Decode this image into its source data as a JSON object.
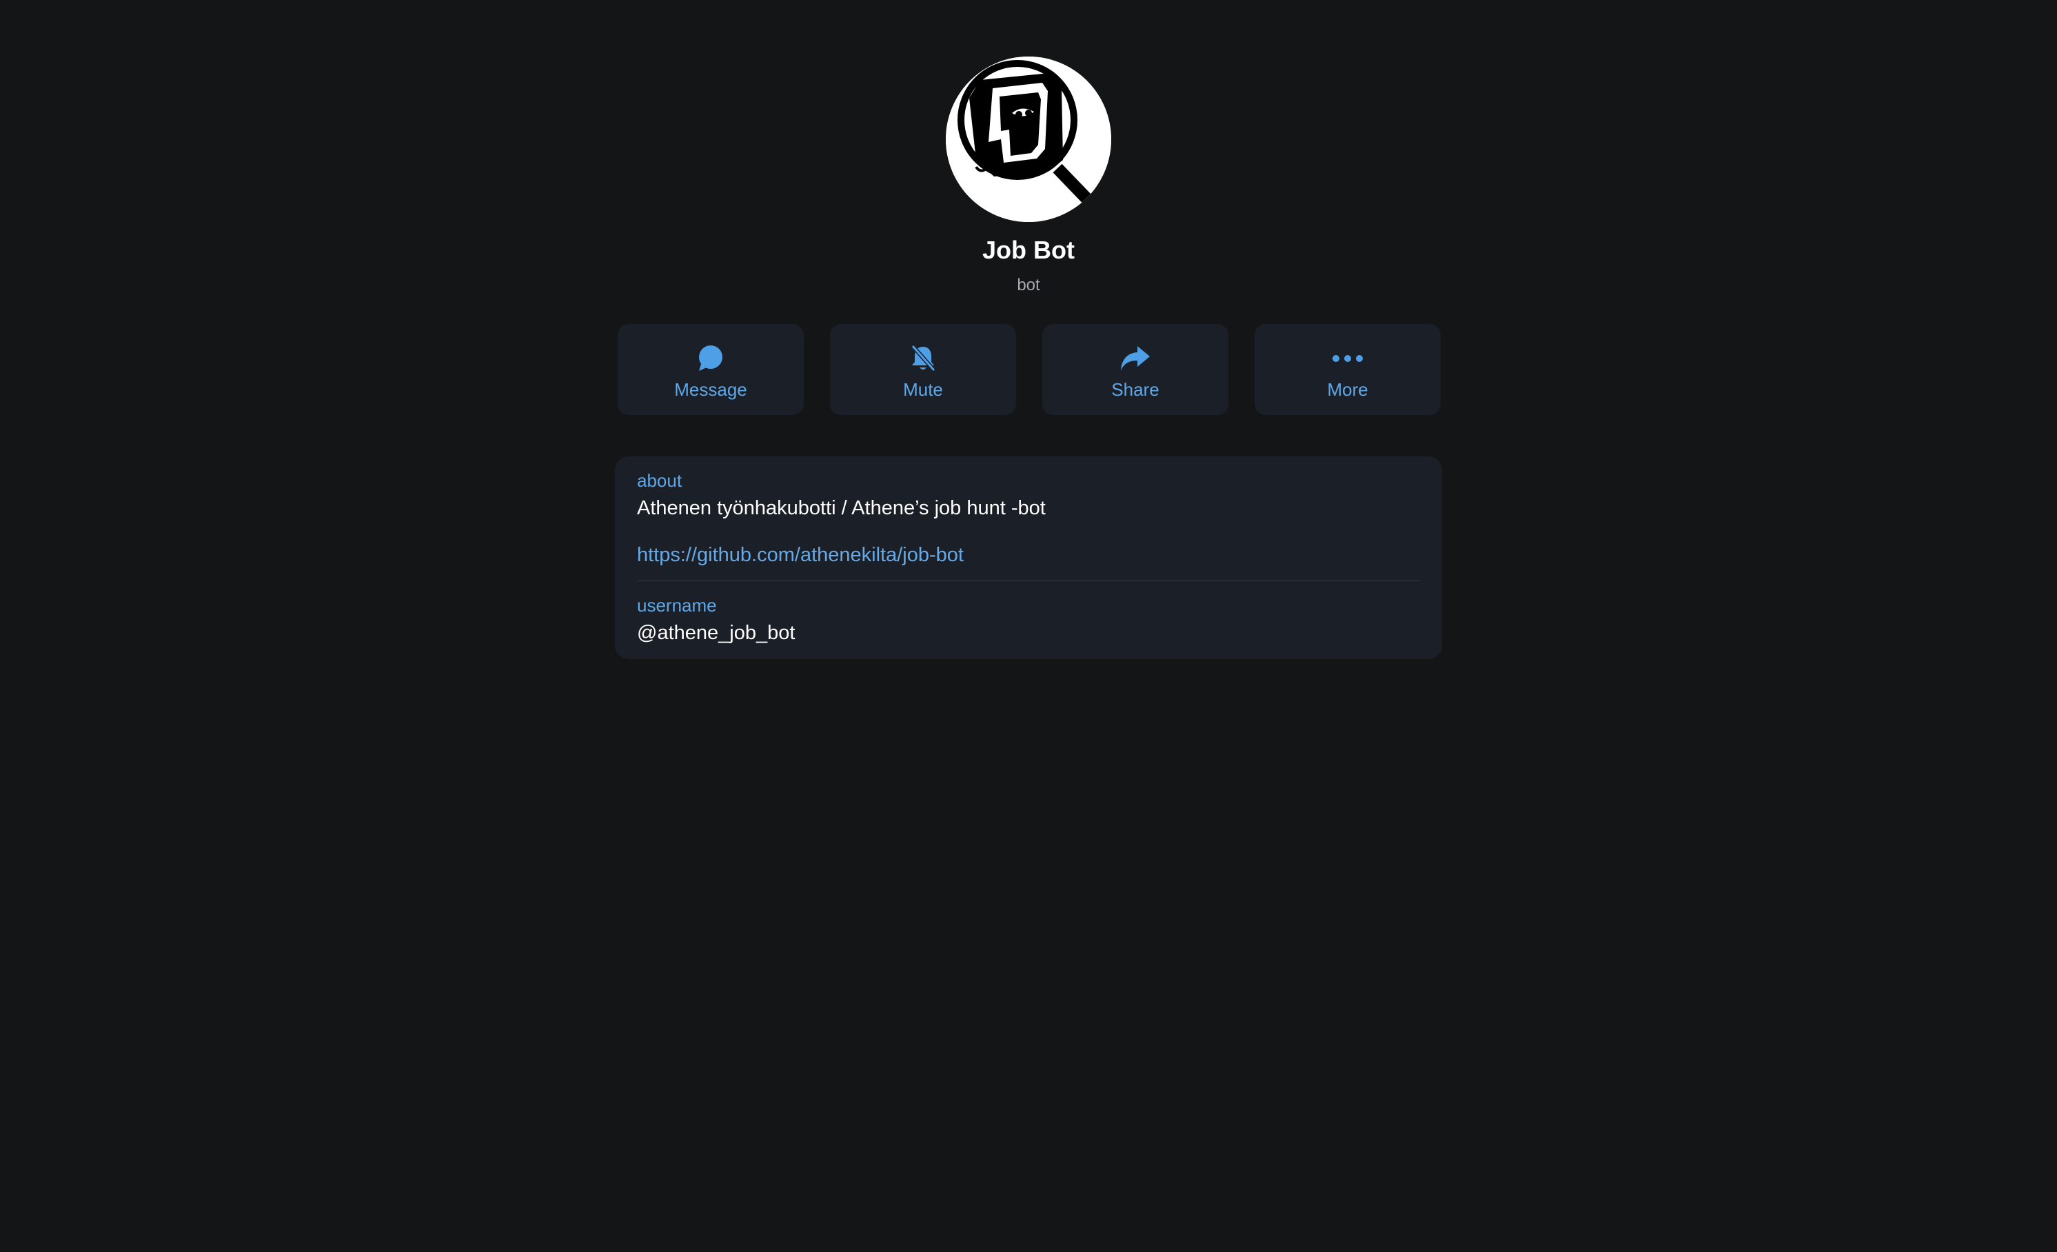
{
  "profile": {
    "name": "Job Bot",
    "subtitle": "bot",
    "avatar_icon": "magnifier-logo-icon"
  },
  "actions": [
    {
      "label": "Message",
      "icon": "chat-bubble-icon"
    },
    {
      "label": "Mute",
      "icon": "bell-slash-icon"
    },
    {
      "label": "Share",
      "icon": "share-arrow-icon"
    },
    {
      "label": "More",
      "icon": "ellipsis-icon"
    }
  ],
  "info": {
    "about_label": "about",
    "about_text": "Athenen työnhakubotti / Athene’s job hunt -bot",
    "about_link": "https://github.com/athenekilta/job-bot",
    "username_label": "username",
    "username_value": "@athene_job_bot"
  },
  "colors": {
    "background": "#141517",
    "card": "#1b2028",
    "accent": "#5ea7e8",
    "text": "#ffffff",
    "muted": "#a7abb1"
  }
}
